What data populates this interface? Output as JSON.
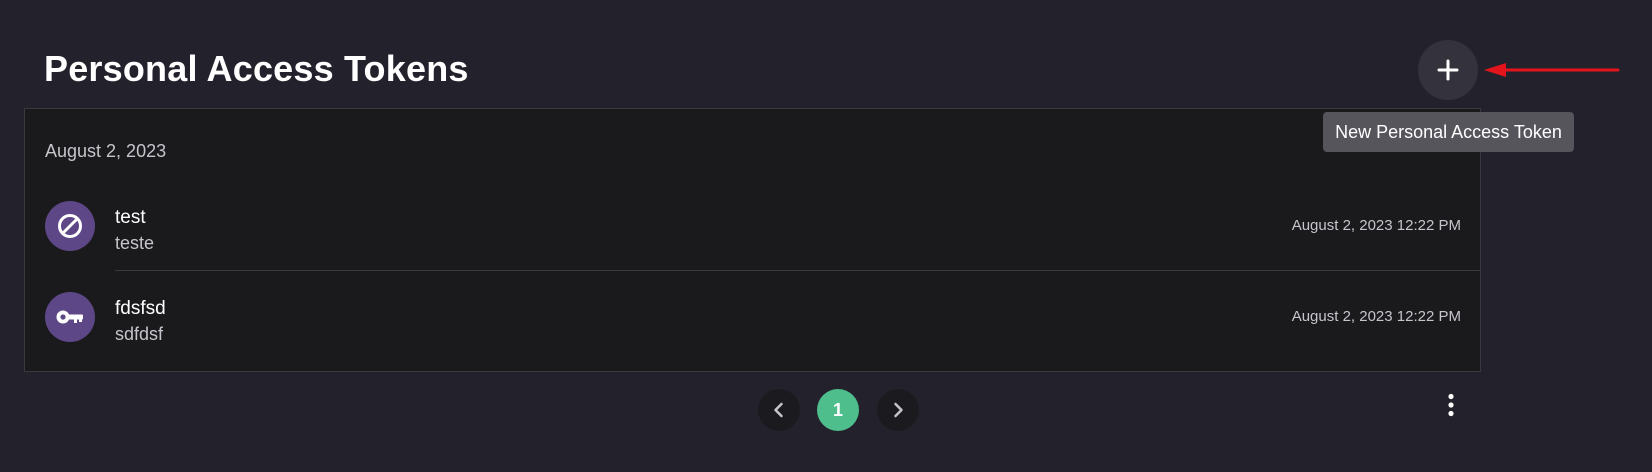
{
  "header": {
    "title": "Personal Access Tokens",
    "add_icon": "plus-icon",
    "tooltip": "New Personal Access Token"
  },
  "tokens": {
    "group_date": "August 2, 2023",
    "items": [
      {
        "name": "test",
        "description": "teste",
        "timestamp": "August 2, 2023 12:22 PM",
        "icon": "block-icon",
        "status": "revoked"
      },
      {
        "name": "fdsfsd",
        "description": "sdfdsf",
        "timestamp": "August 2, 2023 12:22 PM",
        "icon": "key-icon",
        "status": "active"
      }
    ]
  },
  "pagination": {
    "current_page": "1",
    "prev_icon": "chevron-left-icon",
    "next_icon": "chevron-right-icon",
    "more_icon": "more-vertical-icon"
  },
  "colors": {
    "background": "#23222c",
    "card": "#1a1a1d",
    "accent_green": "#4ebf8c",
    "avatar_purple": "#5d4786",
    "annotation_red": "#e3141b"
  }
}
